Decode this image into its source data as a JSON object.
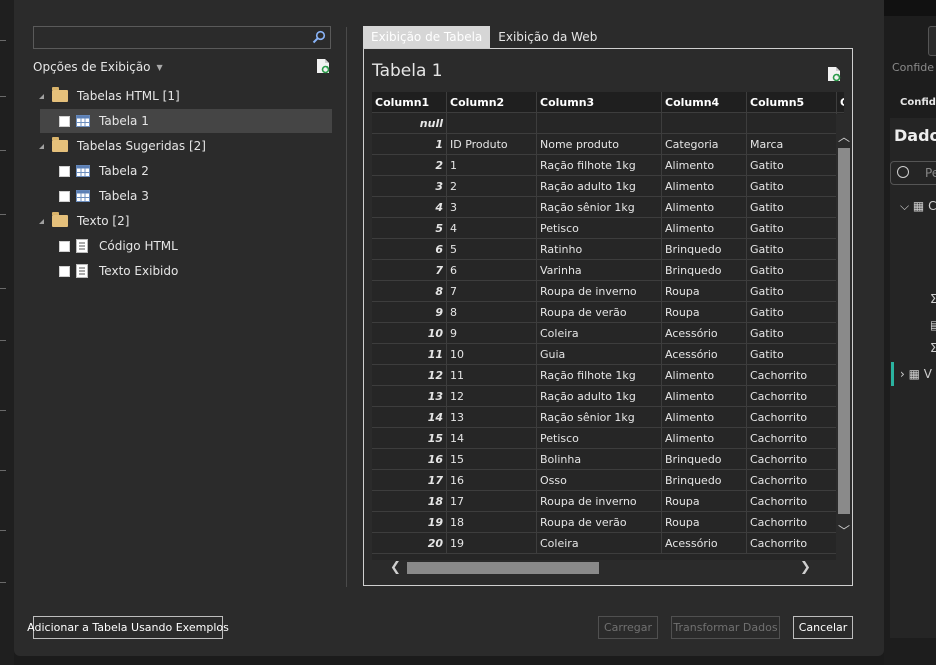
{
  "dialog": {
    "search": {
      "value": "",
      "placeholder": ""
    },
    "display_options": "Opções de Exibição",
    "navigator": [
      {
        "label": "Tabelas HTML [1]",
        "type": "folder"
      },
      {
        "label": "Tabela 1",
        "type": "table",
        "selected": true
      },
      {
        "label": "Tabelas Sugeridas [2]",
        "type": "folder"
      },
      {
        "label": "Tabela 2",
        "type": "table"
      },
      {
        "label": "Tabela 3",
        "type": "table"
      },
      {
        "label": "Texto [2]",
        "type": "folder"
      },
      {
        "label": "Código HTML",
        "type": "document"
      },
      {
        "label": "Texto Exibido",
        "type": "document"
      }
    ],
    "tabs": {
      "table_view": "Exibição de Tabela",
      "web_view": "Exibição da Web"
    },
    "preview_title": "Tabela 1",
    "table": {
      "columns": [
        "Column1",
        "Column2",
        "Column3",
        "Column4",
        "Column5",
        "C"
      ],
      "rows": [
        [
          "null",
          "",
          "",
          "",
          ""
        ],
        [
          "1",
          "ID Produto",
          "Nome produto",
          "Categoria",
          "Marca"
        ],
        [
          "2",
          "1",
          "Ração filhote 1kg",
          "Alimento",
          "Gatito"
        ],
        [
          "3",
          "2",
          "Ração adulto 1kg",
          "Alimento",
          "Gatito"
        ],
        [
          "4",
          "3",
          "Ração sênior 1kg",
          "Alimento",
          "Gatito"
        ],
        [
          "5",
          "4",
          "Petisco",
          "Alimento",
          "Gatito"
        ],
        [
          "6",
          "5",
          "Ratinho",
          "Brinquedo",
          "Gatito"
        ],
        [
          "7",
          "6",
          "Varinha",
          "Brinquedo",
          "Gatito"
        ],
        [
          "8",
          "7",
          "Roupa de inverno",
          "Roupa",
          "Gatito"
        ],
        [
          "9",
          "8",
          "Roupa de verão",
          "Roupa",
          "Gatito"
        ],
        [
          "10",
          "9",
          "Coleira",
          "Acessório",
          "Gatito"
        ],
        [
          "11",
          "10",
          "Guia",
          "Acessório",
          "Gatito"
        ],
        [
          "12",
          "11",
          "Ração filhote 1kg",
          "Alimento",
          "Cachorrito"
        ],
        [
          "13",
          "12",
          "Ração adulto 1kg",
          "Alimento",
          "Cachorrito"
        ],
        [
          "14",
          "13",
          "Ração sênior 1kg",
          "Alimento",
          "Cachorrito"
        ],
        [
          "15",
          "14",
          "Petisco",
          "Alimento",
          "Cachorrito"
        ],
        [
          "16",
          "15",
          "Bolinha",
          "Brinquedo",
          "Cachorrito"
        ],
        [
          "17",
          "16",
          "Osso",
          "Brinquedo",
          "Cachorrito"
        ],
        [
          "18",
          "17",
          "Roupa de inverno",
          "Roupa",
          "Cachorrito"
        ],
        [
          "19",
          "18",
          "Roupa de verão",
          "Roupa",
          "Cachorrito"
        ],
        [
          "20",
          "19",
          "Coleira",
          "Acessório",
          "Cachorrito"
        ]
      ]
    },
    "buttons": {
      "add_table": "Adicionar a Tabela Usando Exemplos",
      "load": "Carregar",
      "transform": "Transformar Dados",
      "cancel": "Cancelar"
    }
  },
  "background": {
    "sensitivity": "Confide",
    "sensitivity_tab": "Confide",
    "data_pane_title": "Dados",
    "search_placeholder": "Pe",
    "tree_items": [
      "C",
      "V"
    ]
  }
}
